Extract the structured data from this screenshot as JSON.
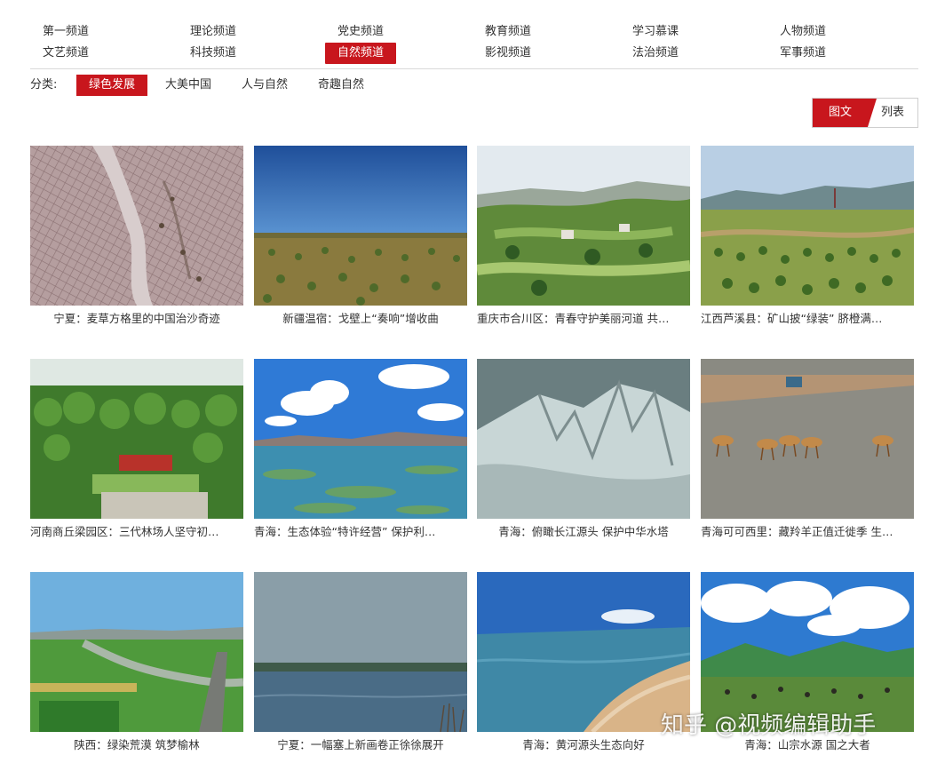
{
  "channels": {
    "row1": [
      "第一频道",
      "理论频道",
      "党史频道",
      "教育频道",
      "学习慕课",
      "人物频道"
    ],
    "row2": [
      "文艺频道",
      "科技频道",
      "自然频道",
      "影视频道",
      "法治频道",
      "军事频道"
    ],
    "active": "自然频道"
  },
  "category": {
    "label": "分类:",
    "items": [
      "绿色发展",
      "大美中国",
      "人与自然",
      "奇趣自然"
    ],
    "active": "绿色发展"
  },
  "view_toggle": {
    "grid_label": "图文",
    "list_label": "列表",
    "active": "图文"
  },
  "videos": [
    {
      "title": "宁夏：麦草方格里的中国治沙奇迹",
      "scene": "straw-checkerboard-desert"
    },
    {
      "title": "新疆温宿：戈壁上“奏响”增收曲",
      "scene": "gobi-orchard"
    },
    {
      "title": "重庆市合川区：青春守护美丽河道 共…",
      "scene": "green-hills-village"
    },
    {
      "title": "江西芦溪县：矿山披“绿装” 脐橙满…",
      "scene": "mine-orange-orchard"
    },
    {
      "title": "河南商丘梁园区：三代林场人坚守初…",
      "scene": "forest-farm"
    },
    {
      "title": "青海：生态体验“特许经营” 保护利…",
      "scene": "lake-wetland-sky"
    },
    {
      "title": "青海：俯瞰长江源头 保护中华水塔",
      "scene": "snow-mountain"
    },
    {
      "title": "青海可可西里：藏羚羊正值迁徙季 生…",
      "scene": "antelope-road"
    },
    {
      "title": "陕西：绿染荒漠 筑梦榆林",
      "scene": "river-fields-highway"
    },
    {
      "title": "宁夏：一幅塞上新画卷正徐徐展开",
      "scene": "lake-grey-sky"
    },
    {
      "title": "青海：黄河源头生态向好",
      "scene": "river-source-lake"
    },
    {
      "title": "青海：山宗水源 国之大者",
      "scene": "grassland-yaks"
    }
  ],
  "watermark": "知乎 @视频编辑助手"
}
